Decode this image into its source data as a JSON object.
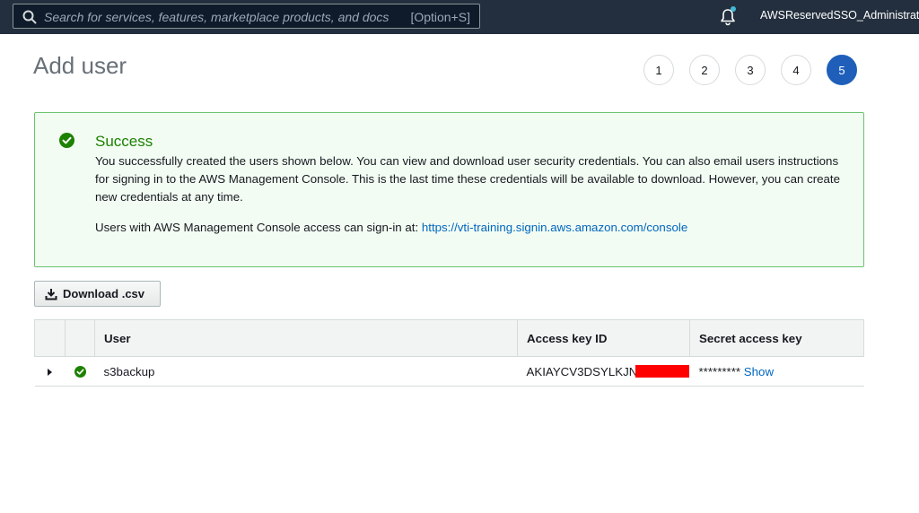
{
  "nav": {
    "search_placeholder": "Search for services, features, marketplace products, and docs",
    "search_shortcut": "[Option+S]",
    "account_name": "AWSReservedSSO_Administrator/"
  },
  "header": {
    "title": "Add user",
    "steps": [
      "1",
      "2",
      "3",
      "4",
      "5"
    ],
    "active_step": "5"
  },
  "alert": {
    "heading": "Success",
    "body": "You successfully created the users shown below. You can view and download user security credentials. You can also email users instructions for signing in to the AWS Management Console. This is the last time these credentials will be available to download. However, you can create new credentials at any time.",
    "signin_text": "Users with AWS Management Console access can sign-in at: ",
    "signin_url": "https://vti-training.signin.aws.amazon.com/console"
  },
  "actions": {
    "download_label": "Download .csv"
  },
  "table": {
    "columns": [
      "",
      "",
      "User",
      "Access key ID",
      "Secret access key"
    ],
    "rows": [
      {
        "user": "s3backup",
        "access_key_id": "AKIAYCV3DSYLKJN",
        "secret_mask": "*********",
        "show_label": "Show"
      }
    ]
  },
  "colors": {
    "nav_bg": "#232f3e",
    "success_green": "#1d8102",
    "active_step": "#1f5fba",
    "link": "#0066c0",
    "redaction": "#ff0000"
  },
  "icons": [
    "search-icon",
    "bell-icon",
    "success-check-icon",
    "download-icon",
    "expand-caret-icon"
  ]
}
